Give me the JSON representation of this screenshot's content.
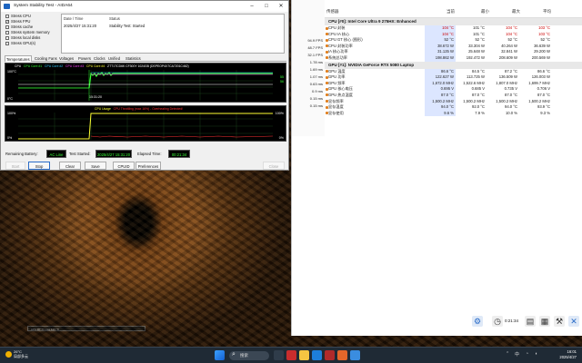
{
  "aida": {
    "title": "System Stability Test - AIDA64",
    "stress": [
      {
        "label": "Stress CPU",
        "checked": false
      },
      {
        "label": "Stress FPU",
        "checked": true
      },
      {
        "label": "Stress cache",
        "checked": false
      },
      {
        "label": "Stress system memory",
        "checked": false
      },
      {
        "label": "Stress local disks",
        "checked": false
      },
      {
        "label": "Stress GPU(s)",
        "checked": false
      }
    ],
    "table_headers": {
      "date": "Date / Time",
      "status": "Status"
    },
    "table_row": {
      "date": "2025/4/27 15:31:20",
      "status": "Stability Test: Started"
    },
    "tabs": [
      "Temperatures",
      "Cooling Fans",
      "Voltages",
      "Powers",
      "Clocks",
      "Unified",
      "Statistics"
    ],
    "graph1": {
      "legend": [
        "CPU",
        "CPU Core #1",
        "CPU Core #2",
        "CPU Core #3",
        "CPU Core #4",
        "ZTT1TCD6K CF300Y 1024GB (DSPEOP4X7CA7201C462)"
      ],
      "ymax": "100°C",
      "ymin": "0°C",
      "time": "15:31:20",
      "r1": "55",
      "r2": "56"
    },
    "graph2": {
      "title_cpu": "CPU Usage",
      "title_throttle": "CPU Throttling (max 16%) - Overheating Detected!",
      "ymax": "100%",
      "ymin": "0%",
      "rmax": "100%",
      "rmin": "0%"
    },
    "info": {
      "battery_label": "Remaining Battery:",
      "battery_value": "AC Line",
      "started_label": "Test Started:",
      "started_value": "2025/4/27 15:31:20",
      "elapsed_label": "Elapsed Time:",
      "elapsed_value": "00:21:34"
    },
    "buttons": {
      "start": "Start",
      "stop": "Stop",
      "clear": "Clear",
      "save": "Save",
      "cpuid": "CPUID",
      "preferences": "Preferences",
      "close": "Close"
    },
    "side_values": [
      "94.9 FPS",
      "48.7 FPS",
      "32.1 FPS",
      "1.78 ms",
      "1.69 ms",
      "1.07 ms",
      "0.63 ms",
      "0.9 ms",
      "0.15 ms",
      "0.15 ms"
    ]
  },
  "sensor": {
    "headers": {
      "name": "传感器",
      "current": "当前",
      "min": "最小",
      "max": "最大",
      "avg": "平均"
    },
    "groups": [
      {
        "title": "CPU [#0]: Intel Core Ultra 9 275HX: Enhanced",
        "rows": [
          {
            "name": "CPU 封装",
            "cur": "104 °C",
            "min": "101 °C",
            "max": "104 °C",
            "avg": "103 °C",
            "red": true
          },
          {
            "name": "CPU IA 核心",
            "cur": "104 °C",
            "min": "101 °C",
            "max": "104 °C",
            "avg": "103 °C",
            "red": true
          },
          {
            "name": "CPU GT 核心 (图形)",
            "cur": "52 °C",
            "min": "52 °C",
            "max": "52 °C",
            "avg": "52 °C",
            "red": false
          },
          {
            "name": "CPU 封装功率",
            "cur": "38.672 W",
            "min": "33.304 W",
            "max": "40.264 W",
            "avg": "36.639 W",
            "red": false
          },
          {
            "name": "IA 核心功率",
            "cur": "31.125 W",
            "min": "25.648 W",
            "max": "32.841 W",
            "avg": "29.200 W",
            "red": false
          },
          {
            "name": "系统总功率",
            "cur": "198.862 W",
            "min": "192.472 W",
            "max": "208.609 W",
            "avg": "200.569 W",
            "red": false
          }
        ]
      },
      {
        "title": "GPU [#1]: NVIDIA GeForce RTX 5080 Laptop",
        "rows": [
          {
            "name": "GPU 温度",
            "cur": "86.6 °C",
            "min": "84.5 °C",
            "max": "87.2 °C",
            "avg": "86.6 °C",
            "red": false
          },
          {
            "name": "GPU 功率",
            "cur": "122.627 W",
            "min": "113.725 W",
            "max": "136.509 W",
            "avg": "126.003 W",
            "red": false
          },
          {
            "name": "GPU 频率",
            "cur": "1,672.0 MHz",
            "min": "1,522.6 MHz",
            "max": "1,807.0 MHz",
            "avg": "1,699.7 MHz",
            "red": false
          },
          {
            "name": "GPU 核心电压",
            "cur": "0.695 V",
            "min": "0.685 V",
            "max": "0.735 V",
            "avg": "0.706 V",
            "red": false
          },
          {
            "name": "GPU 热点温度",
            "cur": "87.0 °C",
            "min": "87.0 °C",
            "max": "87.0 °C",
            "avg": "87.0 °C",
            "red": false
          },
          {
            "name": "显存频率",
            "cur": "1,500.2 MHz",
            "min": "1,500.2 MHz",
            "max": "1,500.2 MHz",
            "avg": "1,500.2 MHz",
            "red": false
          },
          {
            "name": "显存温度",
            "cur": "94.0 °C",
            "min": "92.0 °C",
            "max": "94.0 °C",
            "avg": "93.9 °C",
            "red": false
          },
          {
            "name": "显存使用",
            "cur": "9.6 %",
            "min": "7.9 %",
            "max": "10.0 %",
            "avg": "9.3 %",
            "red": false
          }
        ]
      }
    ],
    "left_labels": [
      "94.9 FPS",
      "48.7 FPS",
      "32.1 FPS",
      "1.78 ms",
      "1.69 ms",
      "1.07 ms",
      "0.63 ms",
      "0.9 ms",
      "0.15 ms",
      "0.15 ms"
    ],
    "footer_time": "0:21:34"
  },
  "desktop": {
    "strip_text": "CPU 87 °C  max 113 °C"
  },
  "taskbar": {
    "weather_temp": "26°C",
    "weather_desc": "局部多云",
    "search_label": "搜索",
    "time": "16:01",
    "date": "2025/4/27",
    "lang": "中"
  },
  "colors": {
    "accent": "#1c64c0",
    "graph_green": "#39ff3a",
    "alert_red": "#cc0000"
  }
}
